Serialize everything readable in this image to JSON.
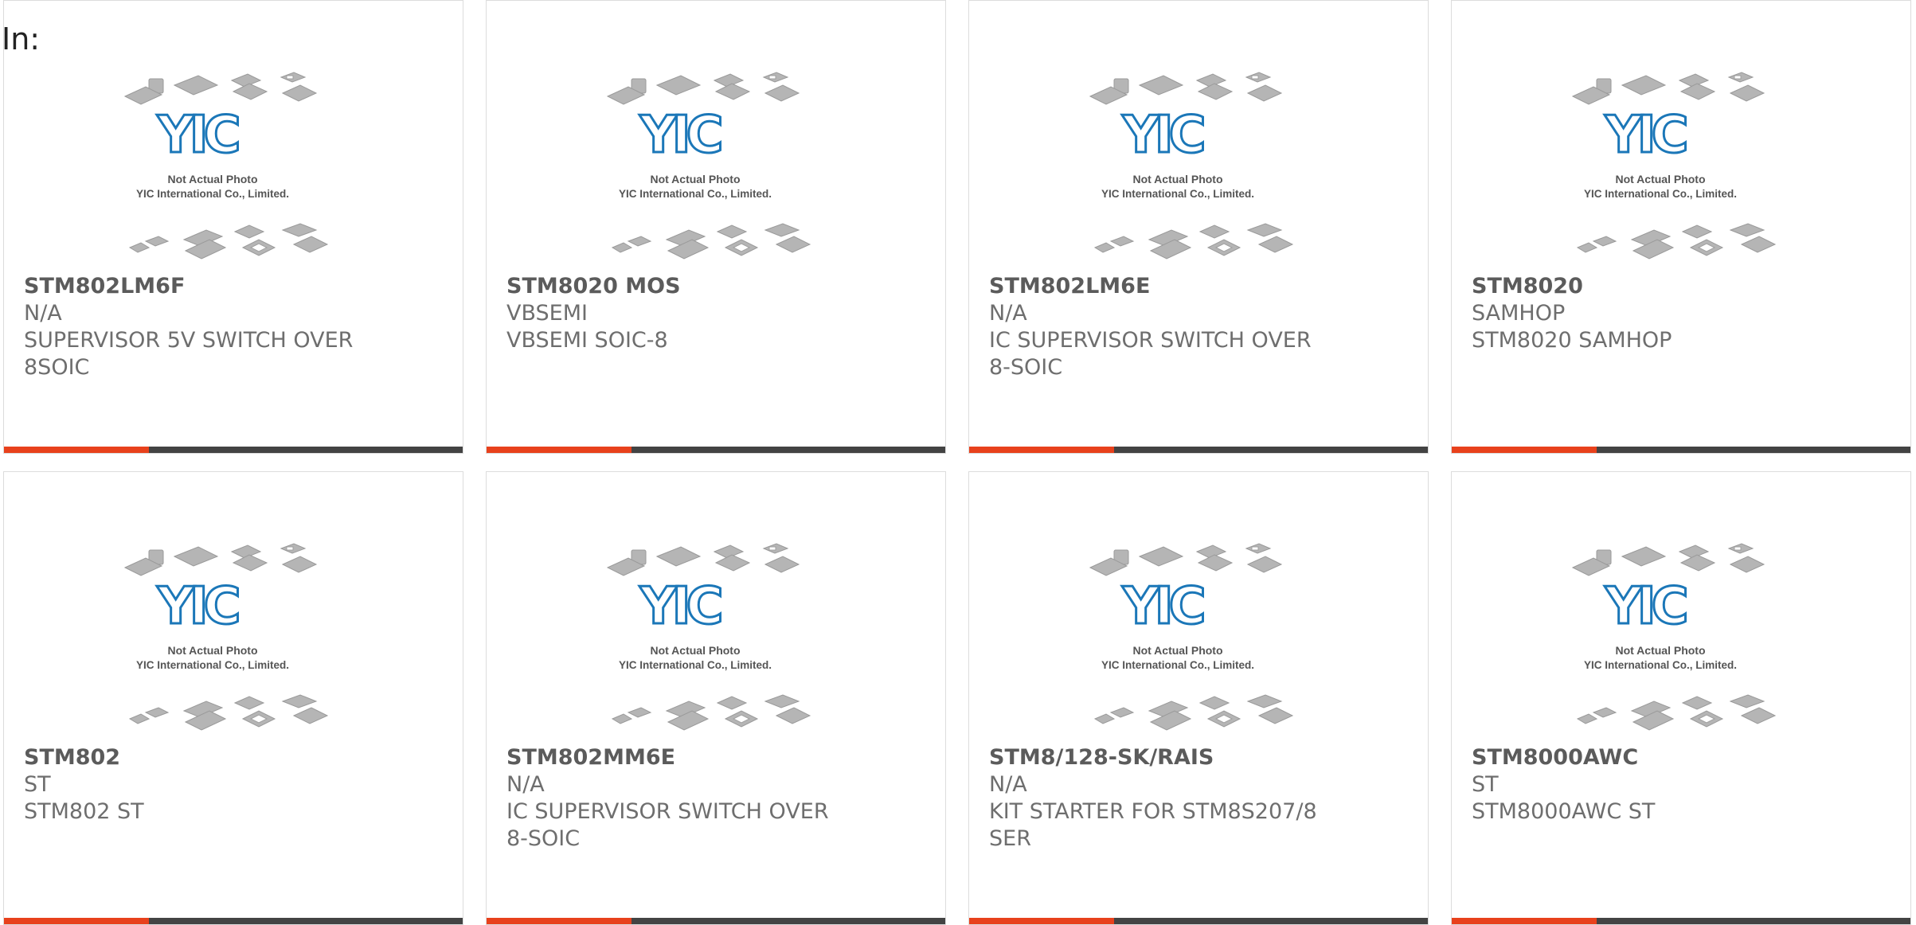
{
  "label": "In:",
  "colors": {
    "accent": "#e8411c",
    "bar": "#434343",
    "logo_blue": "#1b77b8"
  },
  "placeholder": {
    "line1": "Not Actual Photo",
    "line2": "YIC International Co., Limited.",
    "logo_text": "YIC"
  },
  "products": [
    {
      "part": "STM802LM6F",
      "manufacturer": "N/A",
      "description": "SUPERVISOR 5V SWITCH OVER 8SOIC"
    },
    {
      "part": "STM8020 MOS",
      "manufacturer": "VBSEMI",
      "description": "VBSEMI SOIC-8"
    },
    {
      "part": "STM802LM6E",
      "manufacturer": "N/A",
      "description": "IC SUPERVISOR SWITCH OVER 8-SOIC"
    },
    {
      "part": "STM8020",
      "manufacturer": "SAMHOP",
      "description": "STM8020 SAMHOP"
    },
    {
      "part": "STM802",
      "manufacturer": "ST",
      "description": "STM802 ST"
    },
    {
      "part": "STM802MM6E",
      "manufacturer": "N/A",
      "description": "IC SUPERVISOR SWITCH OVER 8-SOIC"
    },
    {
      "part": "STM8/128-SK/RAIS",
      "manufacturer": "N/A",
      "description": "KIT STARTER FOR STM8S207/8 SER"
    },
    {
      "part": "STM8000AWC",
      "manufacturer": "ST",
      "description": "STM8000AWC ST"
    }
  ]
}
